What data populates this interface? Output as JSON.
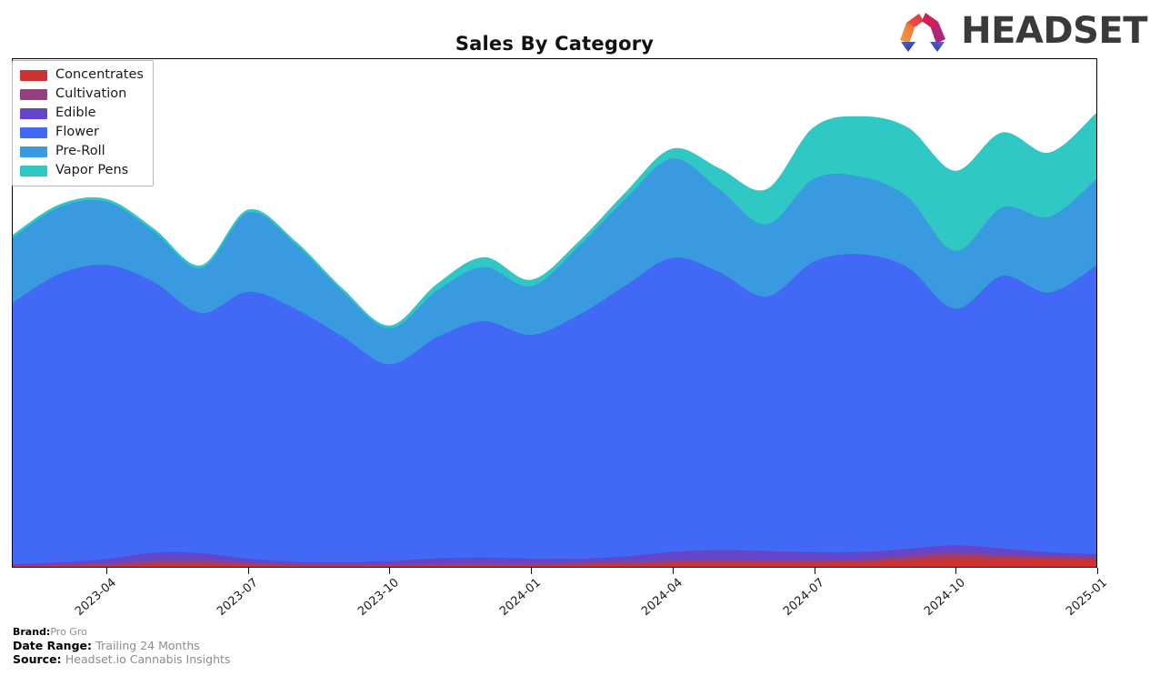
{
  "header": {
    "title": "Sales By Category",
    "logo_text": "HEADSET",
    "logo_mark_name": "headset-logo-mark"
  },
  "legend": {
    "position": "upper-left",
    "items": [
      {
        "label": "Concentrates",
        "color": "#cc3333"
      },
      {
        "label": "Cultivation",
        "color": "#93407d"
      },
      {
        "label": "Edible",
        "color": "#6546c8"
      },
      {
        "label": "Flower",
        "color": "#4169f5"
      },
      {
        "label": "Pre-Roll",
        "color": "#3a9ae0"
      },
      {
        "label": "Vapor Pens",
        "color": "#2fc8c4"
      }
    ]
  },
  "footer": {
    "rows": [
      {
        "key": "Brand:",
        "value": "Pro Gro"
      },
      {
        "key": "Date Range: ",
        "value": "Trailing 24 Months"
      },
      {
        "key": "Source: ",
        "value": "Headset.io Cannabis Insights"
      }
    ]
  },
  "chart_data": {
    "type": "area",
    "stacked": true,
    "title": "Sales By Category",
    "xlabel": "",
    "ylabel": "",
    "grid": false,
    "legend_position": "upper left",
    "y_axis_labels_visible": false,
    "x": [
      "2023-02",
      "2023-03",
      "2023-04",
      "2023-05",
      "2023-06",
      "2023-07",
      "2023-08",
      "2023-09",
      "2023-10",
      "2023-11",
      "2023-12",
      "2024-01",
      "2024-02",
      "2024-03",
      "2024-04",
      "2024-05",
      "2024-06",
      "2024-07",
      "2024-08",
      "2024-09",
      "2024-10",
      "2024-11",
      "2024-12",
      "2025-01"
    ],
    "xtick_labels": [
      "2023-04",
      "2023-07",
      "2023-10",
      "2024-01",
      "2024-04",
      "2024-07",
      "2024-10",
      "2025-01"
    ],
    "xtick_index": [
      2,
      5,
      8,
      11,
      14,
      17,
      20,
      23
    ],
    "series": [
      {
        "name": "Concentrates",
        "color": "#cc3333",
        "values": [
          1.5,
          1.8,
          2.2,
          3.6,
          4.2,
          3.0,
          2.2,
          2.0,
          2.0,
          2.2,
          2.4,
          2.6,
          3.0,
          4.0,
          5.0,
          5.4,
          5.0,
          5.2,
          6.0,
          8.5,
          11.0,
          10.0,
          9.5,
          9.5
        ]
      },
      {
        "name": "Cultivation",
        "color": "#93407d",
        "values": [
          0.8,
          1.2,
          2.0,
          3.6,
          3.6,
          2.0,
          1.2,
          1.0,
          1.0,
          1.2,
          1.4,
          1.6,
          1.8,
          2.2,
          2.6,
          2.8,
          2.6,
          2.6,
          3.0,
          4.5,
          6.0,
          4.0,
          2.2,
          1.5
        ]
      },
      {
        "name": "Edible",
        "color": "#6546c8",
        "values": [
          1.2,
          2.5,
          5.0,
          9.0,
          8.0,
          4.5,
          3.0,
          3.0,
          4.0,
          6.5,
          7.0,
          5.5,
          4.5,
          6.0,
          9.5,
          11.0,
          10.5,
          9.0,
          8.0,
          7.5,
          7.5,
          7.0,
          5.0,
          3.5
        ]
      },
      {
        "name": "Flower",
        "color": "#4169f5",
        "values": [
          290,
          320,
          326,
          300,
          266,
          296,
          280,
          250,
          218,
          245,
          262,
          248,
          270,
          300,
          326,
          308,
          282,
          322,
          330,
          312,
          262,
          302,
          288,
          320
        ]
      },
      {
        "name": "Pre-Roll",
        "color": "#3a9ae0",
        "values": [
          72,
          74,
          70,
          56,
          50,
          88,
          72,
          50,
          40,
          52,
          60,
          54,
          76,
          96,
          110,
          92,
          80,
          92,
          86,
          78,
          64,
          76,
          84,
          96
        ]
      },
      {
        "name": "Vapor Pens",
        "color": "#2fc8c4",
        "values": [
          2,
          2,
          2,
          2,
          2,
          2,
          2,
          2,
          2,
          6,
          10,
          6,
          4,
          6,
          10,
          22,
          38,
          56,
          66,
          76,
          88,
          82,
          70,
          72
        ]
      }
    ]
  }
}
